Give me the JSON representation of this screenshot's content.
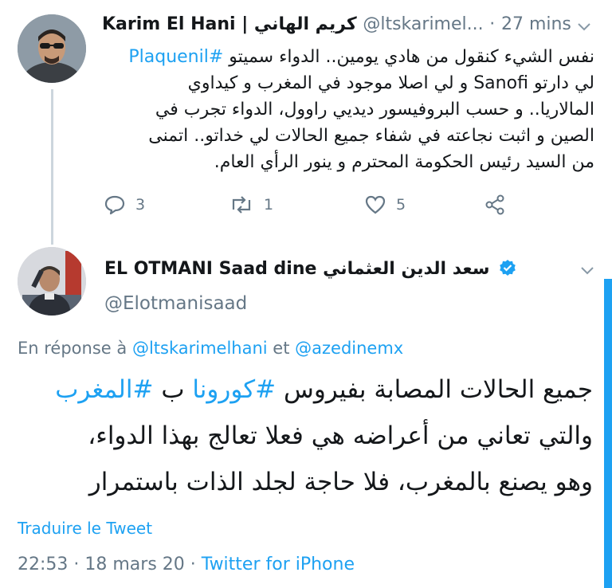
{
  "tweet1": {
    "display_name": "Karim El Hani | كريم الهاني",
    "handle": "@ltskarimel...",
    "separator": "·",
    "time": "27 mins",
    "hashtag": "#Plaquenil",
    "line1": "نفس الشيء كنقول من هادي يومين.. الدواء سميتو",
    "line2_a": "لي دارتو",
    "brand": "Sanofi",
    "line2_b": "و لي اصلا موجود في المغرب و كيداوي",
    "line3": "المالاريا.. و حسب البروفيسور ديديي راوول، الدواء تجرب في",
    "line4": "الصين و اثبت نجاعته في شفاء جميع الحالات لي خداتو.. اتمنى",
    "line5": "من السيد رئيس الحكومة المحترم و ينور الرأي العام.",
    "replies": "3",
    "retweets": "1",
    "likes": "5"
  },
  "tweet2": {
    "display_name": "EL OTMANI Saad dine سعد الدين العثماني",
    "handle": "@Elotmanisaad",
    "reply_prefix": "En réponse à",
    "reply_user1": "@ltskarimelhani",
    "reply_and": "et",
    "reply_user2": "@azedinemx",
    "line1_a": "جميع الحالات المصابة بفيروس",
    "hashtag1": "#كورونا",
    "line1_b": "ب",
    "hashtag2": "#المغرب",
    "line2": "والتي تعاني من أعراضه هي فعلا تعالج بهذا الدواء،",
    "line3": "وهو يصنع بالمغرب، فلا حاجة لجلد الذات باستمرار",
    "translate": "Traduire le Tweet",
    "timestamp": "22:53 · 18 mars 20 ·",
    "source": "Twitter for iPhone"
  },
  "colors": {
    "accent": "#1da1f2",
    "muted": "#657786",
    "verified": "#1da1f2"
  },
  "icons": [
    "reply-icon",
    "retweet-icon",
    "like-icon",
    "share-icon",
    "chevron-down-icon",
    "verified-badge-icon"
  ]
}
